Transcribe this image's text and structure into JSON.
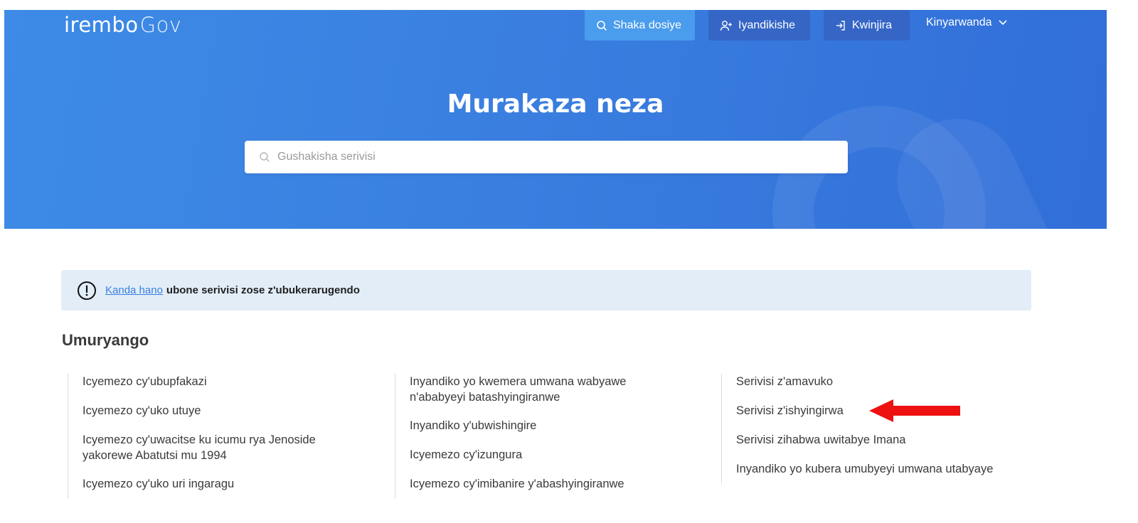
{
  "header": {
    "logo_main": "irembo",
    "logo_sub": "Gov",
    "nav": {
      "search": "Shaka dosiye",
      "register": "Iyandikishe",
      "login": "Kwinjira",
      "language": "Kinyarwanda"
    },
    "title": "Murakaza neza",
    "search_placeholder": "Gushakisha serivisi"
  },
  "notice": {
    "link": "Kanda hano",
    "text": "ubone serivisi zose z'ubukerarugendo"
  },
  "section": {
    "title": "Umuryango",
    "columns": [
      [
        "Icyemezo cy'ubupfakazi",
        "Icyemezo cy'uko utuye",
        "Icyemezo cy'uwacitse ku icumu rya Jenoside yakorewe Abatutsi mu 1994",
        "Icyemezo cy'uko uri ingaragu"
      ],
      [
        "Inyandiko yo kwemera umwana wabyawe n'ababyeyi batashyingiranwe",
        "Inyandiko y'ubwishingire",
        "Icyemezo cy'izungura",
        "Icyemezo cy'imibanire y'abashyingiranwe"
      ],
      [
        "Serivisi z'amavuko",
        "Serivisi z'ishyingirwa",
        "Serivisi zihabwa uwitabye Imana",
        "Inyandiko yo kubera umubyeyi umwana utabyaye"
      ]
    ]
  },
  "colors": {
    "hero_blue": "#3a7fe0",
    "notice_bg": "#e2edf8",
    "arrow_red": "#ee1111"
  }
}
